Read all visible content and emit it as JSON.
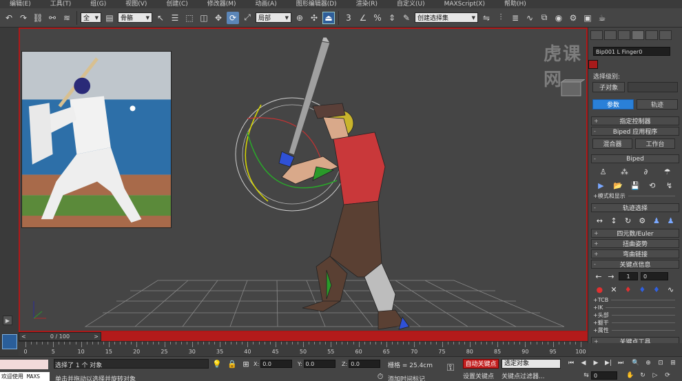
{
  "menu": [
    "编辑(E)",
    "工具(T)",
    "组(G)",
    "视图(V)",
    "创建(C)",
    "修改器(M)",
    "动画(A)",
    "图形编辑器(D)",
    "渲染(R)",
    "自定义(U)",
    "MAXScript(X)",
    "帮助(H)"
  ],
  "toolbar": {
    "layer_dropdown": "骨骼",
    "ref_coord_dropdown": "局部",
    "selection_set_dropdown": "创建选择集",
    "snap_label": "3"
  },
  "viewport": {
    "watermark": "虎课网",
    "border_color": "#b01818"
  },
  "command_panel": {
    "object_name": "Bip001 L Finger0",
    "object_color": "#a81b1b",
    "selection_level_label": "选择级别:",
    "sub_object_button": "子对象",
    "tab_params": "参数",
    "tab_motion": "轨迹",
    "rollouts": {
      "assign_controller": "指定控制器",
      "biped_apps": "Biped 应用程序",
      "mixer": "混合器",
      "workbench": "工作台",
      "biped": "Biped",
      "mode_display": "+模式和显示",
      "track_selection": "轨迹选择",
      "quaternion_euler": "四元数/Euler",
      "twist_poses": "扭曲姿势",
      "bend_links": "弯曲链接",
      "key_info": "关键点信息",
      "key_number": "1",
      "key_time": "0",
      "tcb": "+TCB",
      "ik": "+IK",
      "head": "+头部",
      "body": "+躯干",
      "props": "+属性",
      "key_tools": "关键点工具"
    },
    "accent_color": "#2a80d8"
  },
  "timeline": {
    "frame_display": "0 / 100",
    "ticks": [
      0,
      5,
      10,
      15,
      20,
      25,
      30,
      35,
      40,
      45,
      50,
      55,
      60,
      65,
      70,
      75,
      80,
      85,
      90,
      95,
      100
    ]
  },
  "status": {
    "listener_label": "欢迎使用 MAXS",
    "selection_text": "选择了 1 个 对象",
    "prompt_text": "单击并拖动以选择并旋转对象",
    "x_label": "X:",
    "x_value": "0.0",
    "y_label": "Y:",
    "y_value": "0.0",
    "z_label": "Z:",
    "z_value": "0.0",
    "grid_text": "栅格 = 25.4cm",
    "add_time_tag": "添加时间标记",
    "auto_key": "自动关键点",
    "set_key": "设置关键点",
    "key_mode_dropdown": "选定对象",
    "key_filters": "关键点过滤器...",
    "current_frame": "0"
  }
}
